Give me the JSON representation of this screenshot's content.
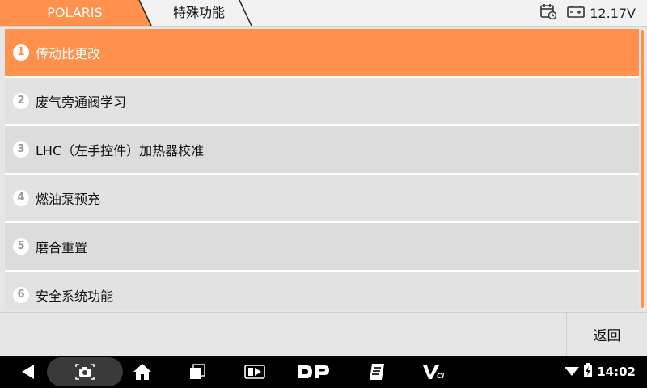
{
  "header": {
    "brand": "POLARIS",
    "page": "特殊功能",
    "voltage": "12.17V",
    "calendar_icon": "calendar-clock-icon",
    "battery_icon": "battery-icon"
  },
  "menu": {
    "items": [
      {
        "num": "1",
        "label": "传动比更改",
        "selected": true
      },
      {
        "num": "2",
        "label": "废气旁通阀学习"
      },
      {
        "num": "3",
        "label": "LHC（左手控件）加热器校准"
      },
      {
        "num": "4",
        "label": "燃油泵预充"
      },
      {
        "num": "5",
        "label": "磨合重置"
      },
      {
        "num": "6",
        "label": "安全系统功能"
      }
    ]
  },
  "footer": {
    "back_label": "返回"
  },
  "system": {
    "time": "14:02"
  },
  "colors": {
    "accent": "#ff914d",
    "brand_tab": "#ff914d",
    "navbar": "#000000"
  }
}
